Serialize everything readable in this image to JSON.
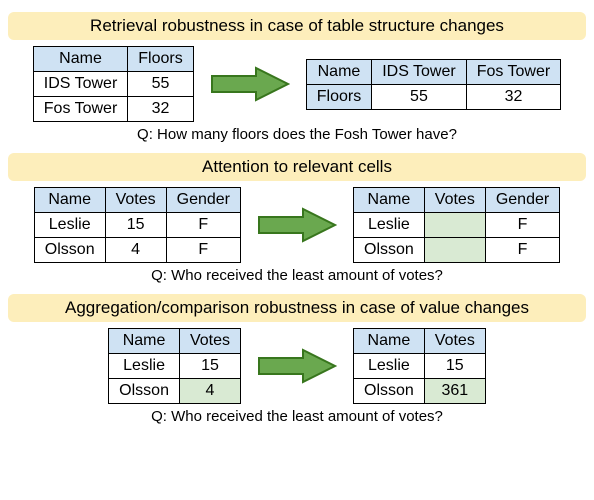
{
  "colors": {
    "header_bg": "#fdeebb",
    "table_header_bg": "#cfe2f3",
    "highlight_bg": "#d9ead3",
    "arrow_fill": "#6aa84f",
    "arrow_stroke": "#38761d"
  },
  "sections": [
    {
      "title": "Retrieval robustness in case of table structure changes",
      "question": "Q: How many floors does the Fosh Tower have?",
      "left_table": {
        "headers": [
          "Name",
          "Floors"
        ],
        "rows": [
          [
            {
              "t": "IDS Tower"
            },
            {
              "t": "55"
            }
          ],
          [
            {
              "t": "Fos Tower"
            },
            {
              "t": "32",
              "bold": true
            }
          ]
        ]
      },
      "right_table": {
        "type": "row_header",
        "col_headers": [
          "Name",
          "IDS Tower",
          "Fos Tower"
        ],
        "rows": [
          [
            {
              "t": "Floors",
              "header": true
            },
            {
              "t": "55"
            },
            {
              "t": "32",
              "bold": true
            }
          ]
        ]
      }
    },
    {
      "title": "Attention to relevant cells",
      "question": "Q: Who received the least amount of votes?",
      "left_table": {
        "headers": [
          "Name",
          "Votes",
          "Gender"
        ],
        "rows": [
          [
            {
              "t": "Leslie"
            },
            {
              "t": "15"
            },
            {
              "t": "F"
            }
          ],
          [
            {
              "t": "Olsson",
              "bold": true
            },
            {
              "t": "4"
            },
            {
              "t": "F"
            }
          ]
        ]
      },
      "right_table": {
        "headers": [
          "Name",
          "Votes",
          "Gender"
        ],
        "rows": [
          [
            {
              "t": "Leslie"
            },
            {
              "t": "",
              "hl": true
            },
            {
              "t": "F"
            }
          ],
          [
            {
              "t": "Olsson"
            },
            {
              "t": "",
              "hl": true
            },
            {
              "t": "F"
            }
          ]
        ]
      }
    },
    {
      "title": "Aggregation/comparison robustness in case of value changes",
      "question": "Q: Who received the least amount of votes?",
      "left_table": {
        "headers": [
          "Name",
          "Votes"
        ],
        "rows": [
          [
            {
              "t": "Leslie"
            },
            {
              "t": "15"
            }
          ],
          [
            {
              "t": "Olsson",
              "bold": true
            },
            {
              "t": "4",
              "hl": true
            }
          ]
        ]
      },
      "right_table": {
        "headers": [
          "Name",
          "Votes"
        ],
        "rows": [
          [
            {
              "t": "Leslie",
              "bold": true
            },
            {
              "t": "15"
            }
          ],
          [
            {
              "t": "Olsson"
            },
            {
              "t": "361",
              "hl": true
            }
          ]
        ]
      }
    }
  ]
}
